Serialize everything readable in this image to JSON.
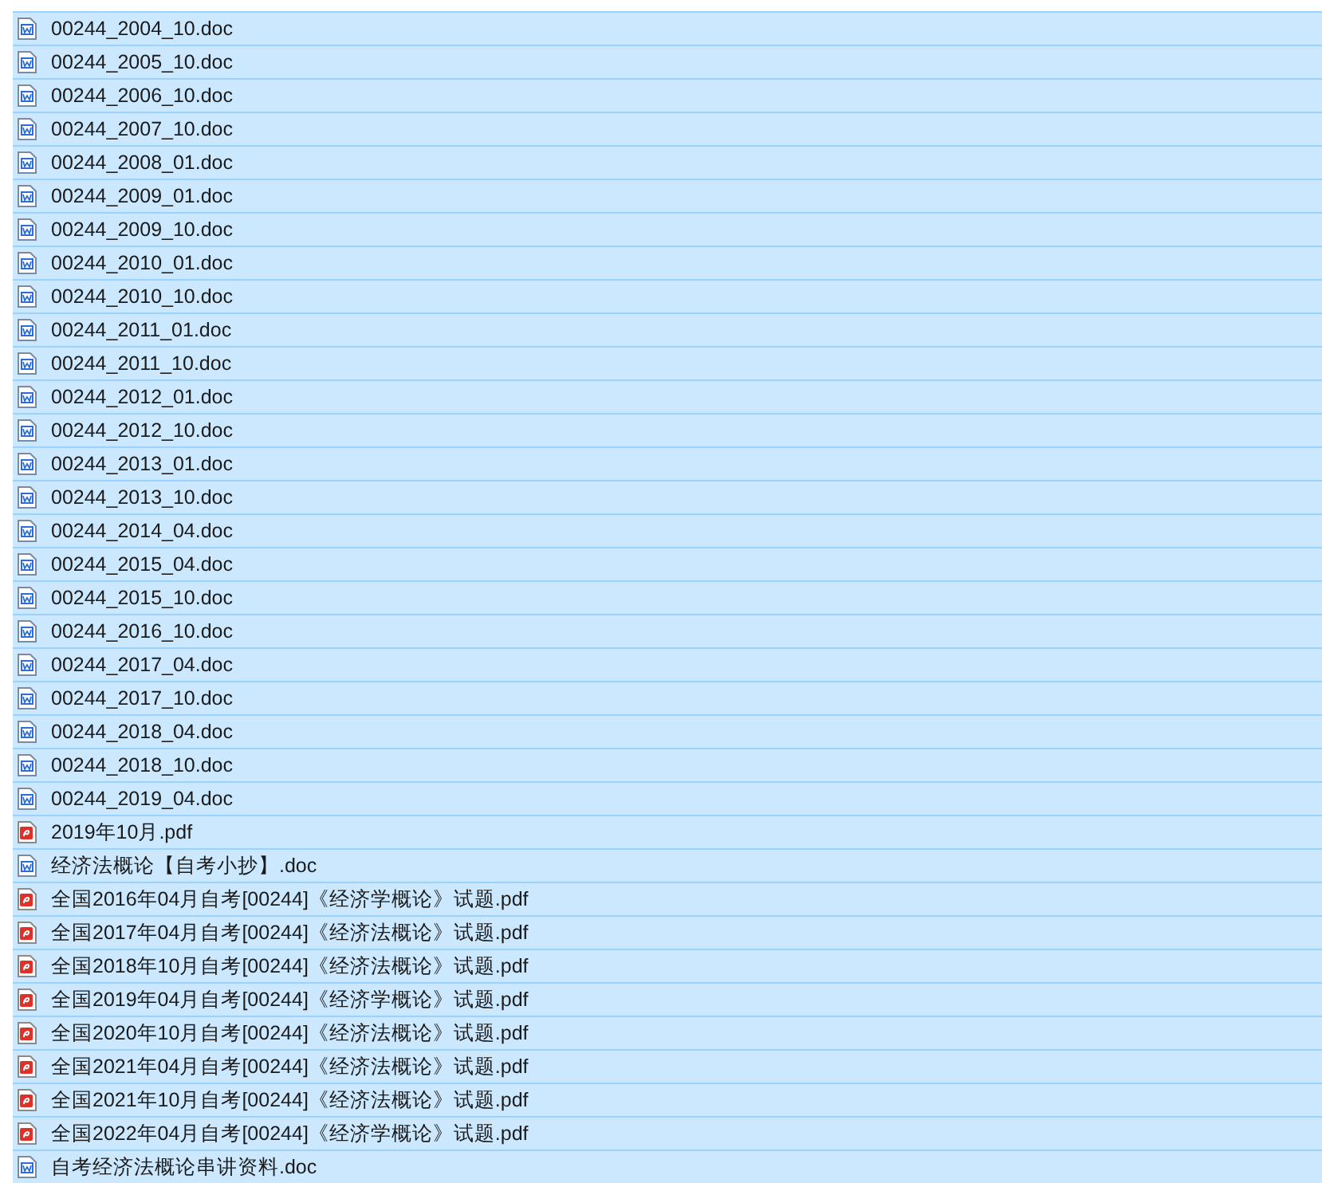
{
  "files": [
    {
      "name": "00244_2004_10.doc",
      "kind": "doc",
      "selected": true
    },
    {
      "name": "00244_2005_10.doc",
      "kind": "doc",
      "selected": true
    },
    {
      "name": "00244_2006_10.doc",
      "kind": "doc",
      "selected": true
    },
    {
      "name": "00244_2007_10.doc",
      "kind": "doc",
      "selected": true
    },
    {
      "name": "00244_2008_01.doc",
      "kind": "doc",
      "selected": true
    },
    {
      "name": "00244_2009_01.doc",
      "kind": "doc",
      "selected": true
    },
    {
      "name": "00244_2009_10.doc",
      "kind": "doc",
      "selected": true
    },
    {
      "name": "00244_2010_01.doc",
      "kind": "doc",
      "selected": true
    },
    {
      "name": "00244_2010_10.doc",
      "kind": "doc",
      "selected": true
    },
    {
      "name": "00244_2011_01.doc",
      "kind": "doc",
      "selected": true
    },
    {
      "name": "00244_2011_10.doc",
      "kind": "doc",
      "selected": true
    },
    {
      "name": "00244_2012_01.doc",
      "kind": "doc",
      "selected": true
    },
    {
      "name": "00244_2012_10.doc",
      "kind": "doc",
      "selected": true
    },
    {
      "name": "00244_2013_01.doc",
      "kind": "doc",
      "selected": true
    },
    {
      "name": "00244_2013_10.doc",
      "kind": "doc",
      "selected": true
    },
    {
      "name": "00244_2014_04.doc",
      "kind": "doc",
      "selected": true
    },
    {
      "name": "00244_2015_04.doc",
      "kind": "doc",
      "selected": true
    },
    {
      "name": "00244_2015_10.doc",
      "kind": "doc",
      "selected": true
    },
    {
      "name": "00244_2016_10.doc",
      "kind": "doc",
      "selected": true
    },
    {
      "name": "00244_2017_04.doc",
      "kind": "doc",
      "selected": true
    },
    {
      "name": "00244_2017_10.doc",
      "kind": "doc",
      "selected": true
    },
    {
      "name": "00244_2018_04.doc",
      "kind": "doc",
      "selected": true
    },
    {
      "name": "00244_2018_10.doc",
      "kind": "doc",
      "selected": true
    },
    {
      "name": "00244_2019_04.doc",
      "kind": "doc",
      "selected": true
    },
    {
      "name": "2019年10月.pdf",
      "kind": "pdf",
      "selected": true
    },
    {
      "name": "经济法概论【自考小抄】.doc",
      "kind": "doc",
      "selected": true
    },
    {
      "name": "全国2016年04月自考[00244]《经济学概论》试题.pdf",
      "kind": "pdf",
      "selected": true
    },
    {
      "name": "全国2017年04月自考[00244]《经济法概论》试题.pdf",
      "kind": "pdf",
      "selected": true
    },
    {
      "name": "全国2018年10月自考[00244]《经济法概论》试题.pdf",
      "kind": "pdf",
      "selected": true
    },
    {
      "name": "全国2019年04月自考[00244]《经济学概论》试题.pdf",
      "kind": "pdf",
      "selected": true
    },
    {
      "name": "全国2020年10月自考[00244]《经济法概论》试题.pdf",
      "kind": "pdf",
      "selected": true
    },
    {
      "name": "全国2021年04月自考[00244]《经济法概论》试题.pdf",
      "kind": "pdf",
      "selected": true
    },
    {
      "name": "全国2021年10月自考[00244]《经济法概论》试题.pdf",
      "kind": "pdf",
      "selected": true
    },
    {
      "name": "全国2022年04月自考[00244]《经济学概论》试题.pdf",
      "kind": "pdf",
      "selected": true
    },
    {
      "name": "自考经济法概论串讲资料.doc",
      "kind": "doc",
      "selected": true
    }
  ]
}
